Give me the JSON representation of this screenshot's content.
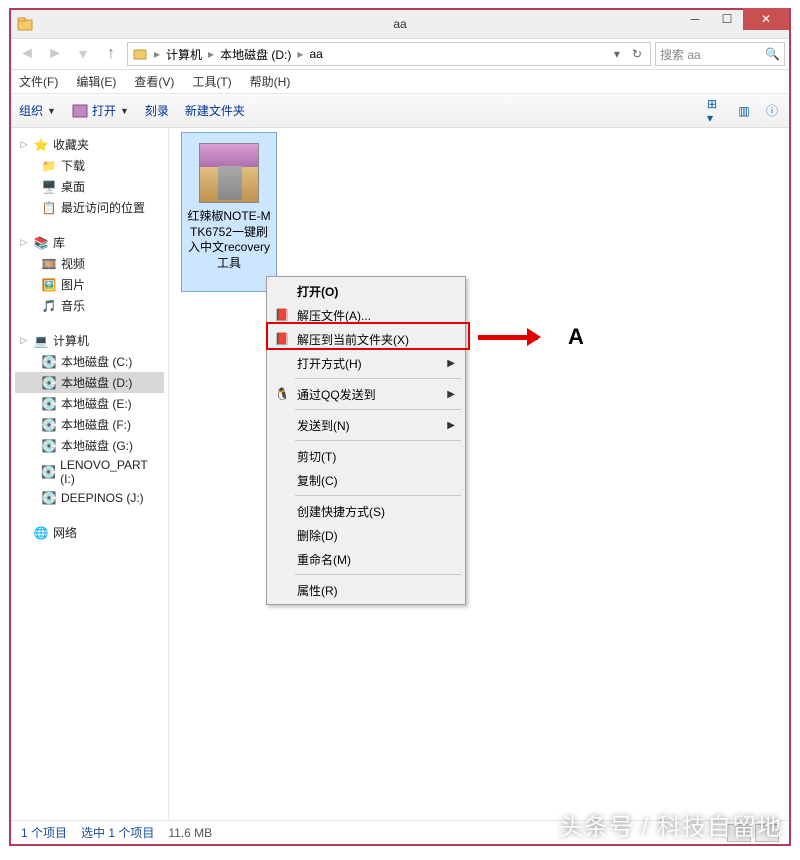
{
  "window": {
    "title": "aa"
  },
  "nav": {
    "crumbs": [
      "计算机",
      "本地磁盘 (D:)",
      "aa"
    ],
    "search_placeholder": "搜索 aa"
  },
  "menubar": [
    "文件(F)",
    "编辑(E)",
    "查看(V)",
    "工具(T)",
    "帮助(H)"
  ],
  "toolbar": {
    "organize": "组织",
    "open": "打开",
    "burn": "刻录",
    "newfolder": "新建文件夹"
  },
  "sidebar": {
    "favorites": {
      "label": "收藏夹",
      "items": [
        "下载",
        "桌面",
        "最近访问的位置"
      ]
    },
    "libraries": {
      "label": "库",
      "items": [
        "视频",
        "图片",
        "音乐"
      ]
    },
    "computer": {
      "label": "计算机",
      "items": [
        "本地磁盘 (C:)",
        "本地磁盘 (D:)",
        "本地磁盘 (E:)",
        "本地磁盘 (F:)",
        "本地磁盘 (G:)",
        "LENOVO_PART (I:)",
        "DEEPINOS (J:)"
      ],
      "selected_index": 1
    },
    "network": {
      "label": "网络"
    }
  },
  "file": {
    "name": "红辣椒NOTE-MTK6752一键刷入中文recovery工具"
  },
  "context_menu": {
    "open": "打开(O)",
    "extract_files": "解压文件(A)...",
    "extract_here": "解压到当前文件夹(X)",
    "open_with": "打开方式(H)",
    "send_qq": "通过QQ发送到",
    "send_to": "发送到(N)",
    "cut": "剪切(T)",
    "copy": "复制(C)",
    "shortcut": "创建快捷方式(S)",
    "delete": "删除(D)",
    "rename": "重命名(M)",
    "properties": "属性(R)"
  },
  "annotation": {
    "label": "A"
  },
  "status": {
    "items": "1 个项目",
    "selected": "选中 1 个项目",
    "size": "11.6 MB"
  },
  "watermark": "头条号 / 科技自留地"
}
